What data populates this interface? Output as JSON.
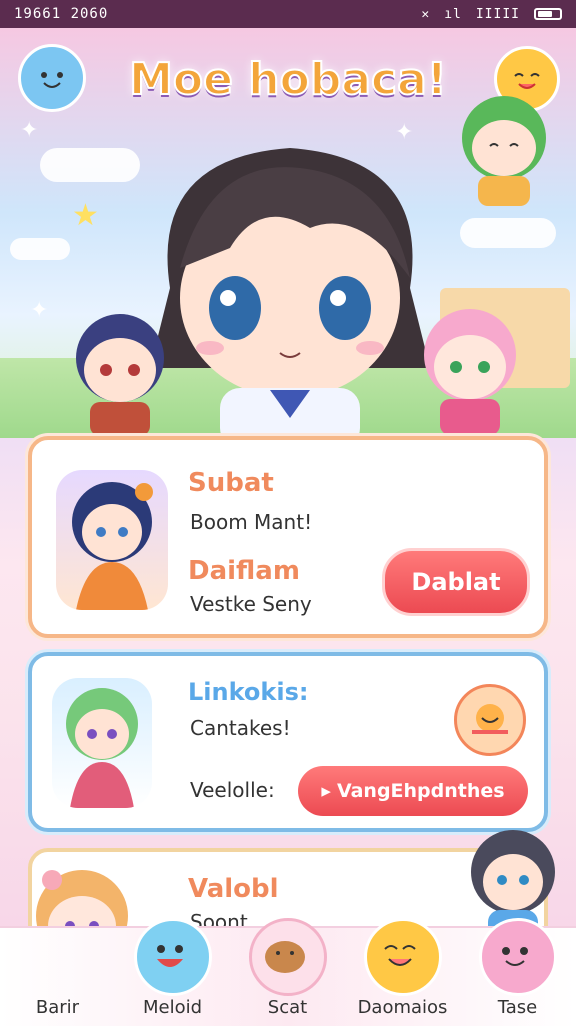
{
  "status_bar": {
    "time": "19661 2060",
    "signal_text": "ıl",
    "wifi_text": "lll",
    "net_text": "IIIII"
  },
  "app": {
    "title": "Moe hobaca!"
  },
  "cards": [
    {
      "heading1": "Subat",
      "text1": "Boom Mant!",
      "heading2": "Daiflam",
      "text2": "Vestke Seny",
      "button": "Dablat"
    },
    {
      "heading1": "Linkokis:",
      "text1": "Cantakes!",
      "text2": "Veelolle:",
      "button": "VangEhpdnthes"
    },
    {
      "heading1": "Valobl",
      "text1": "Soont"
    }
  ],
  "nav": [
    {
      "label": "Barir",
      "icon": "girl-avatar-icon"
    },
    {
      "label": "Meloid",
      "icon": "blue-blob-icon"
    },
    {
      "label": "Scat",
      "icon": "cookie-icon"
    },
    {
      "label": "Daomaios",
      "icon": "orange-blob-icon"
    },
    {
      "label": "Tase",
      "icon": "pink-blob-icon"
    }
  ],
  "colors": {
    "accent_orange": "#f08a5d",
    "accent_blue": "#5aa8e8",
    "button_red": "#f25d5d"
  }
}
